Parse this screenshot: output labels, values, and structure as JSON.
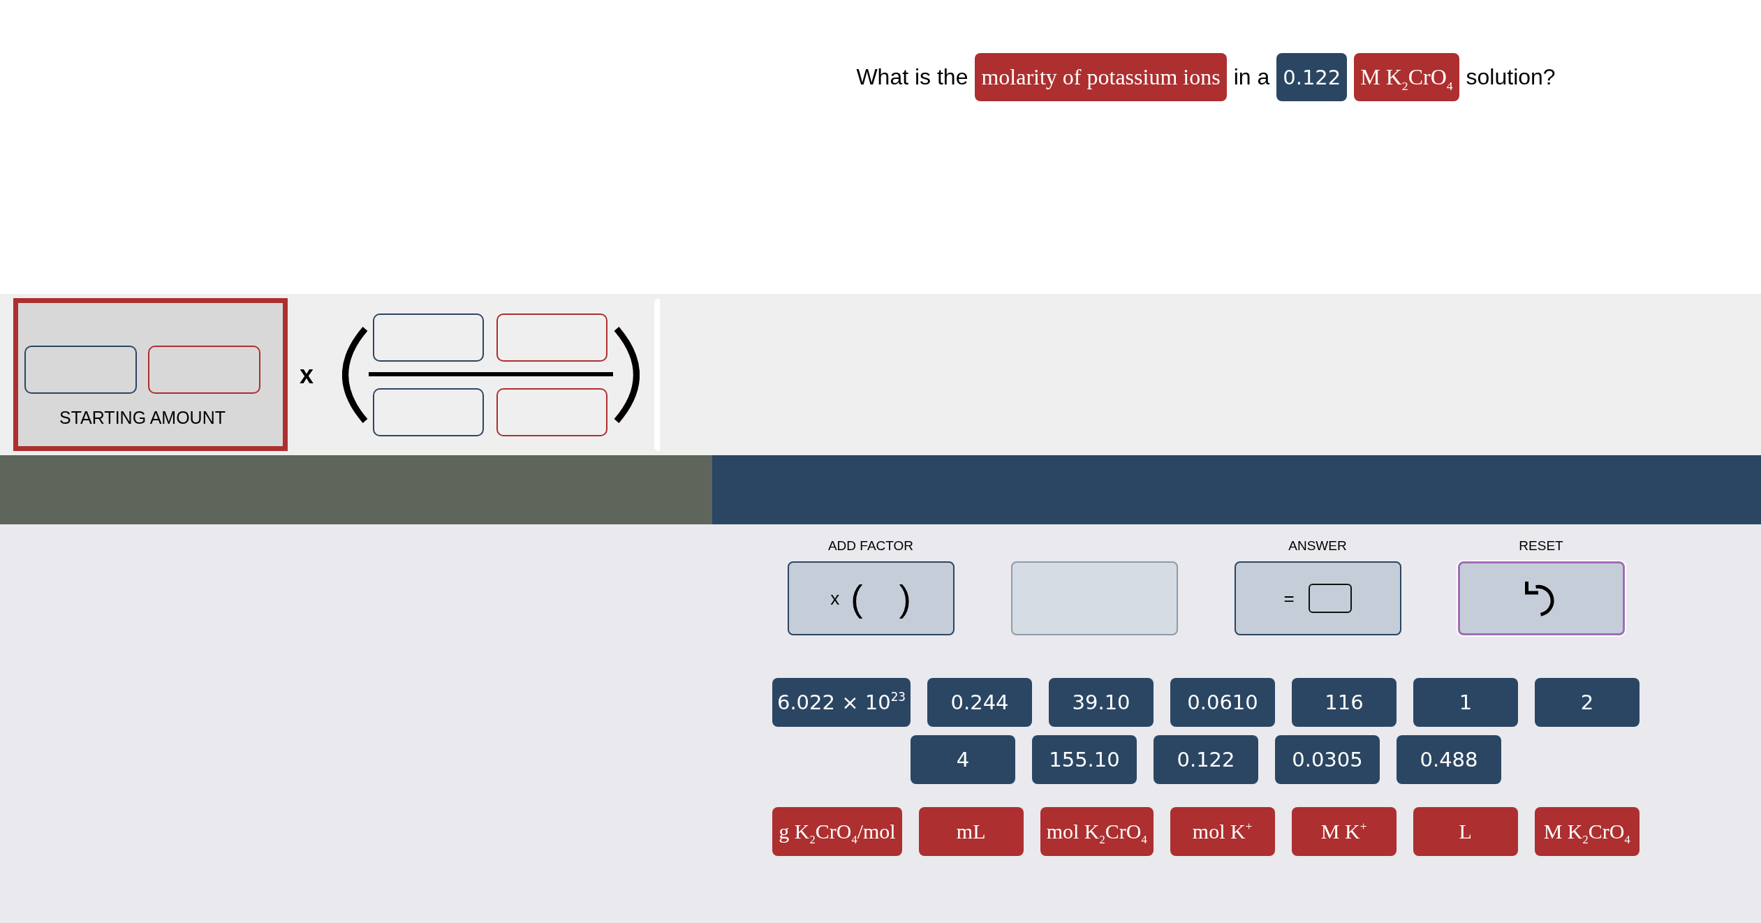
{
  "question": {
    "parts": [
      {
        "kind": "text",
        "text": "What is the"
      },
      {
        "kind": "unit",
        "text": "molarity of potassium ions"
      },
      {
        "kind": "text",
        "text": "in a"
      },
      {
        "kind": "number",
        "text": "0.122"
      },
      {
        "kind": "unit",
        "text": "M K$_{2}$CrO$_{4}$"
      },
      {
        "kind": "text",
        "text": "solution?"
      }
    ]
  },
  "equation": {
    "starting_amount": {
      "slots": [
        {
          "kind": "number"
        },
        {
          "kind": "unit"
        }
      ],
      "label": "STARTING AMOUNT"
    },
    "operator": "x",
    "factors": [
      {
        "numerator": [
          {
            "kind": "number"
          },
          {
            "kind": "unit"
          }
        ],
        "denominator": [
          {
            "kind": "number"
          },
          {
            "kind": "unit"
          }
        ]
      }
    ]
  },
  "controls": [
    {
      "kind": "add_factor",
      "label": "ADD FACTOR",
      "symbols": [
        {
          "kind": "operator",
          "text": "x"
        },
        {
          "kind": "bracket",
          "text": "("
        },
        {
          "kind": "bracket",
          "text": ")"
        }
      ],
      "disabled": false,
      "focused": false
    },
    {
      "kind": "blank",
      "disabled": true,
      "focused": false
    },
    {
      "kind": "answer",
      "label": "ANSWER",
      "symbols": [
        {
          "kind": "operator",
          "text": "="
        }
      ],
      "disabled": false,
      "focused": false
    },
    {
      "kind": "reset",
      "label": "RESET",
      "disabled": false,
      "focused": true
    }
  ],
  "numbers": [
    "6.022 × 10$^{23}$",
    "0.244",
    "39.10",
    "0.0610",
    "116",
    "1",
    "2",
    "4",
    "155.10",
    "0.122",
    "0.0305",
    "0.488"
  ],
  "units": [
    "g K$_{2}$CrO$_{4}$/mol",
    "mL",
    "mol K$_{2}$CrO$_{4}$",
    "mol K$^{+}$",
    "M K$^{+}$",
    "L",
    "M K$_{2}$CrO$_{4}$"
  ]
}
